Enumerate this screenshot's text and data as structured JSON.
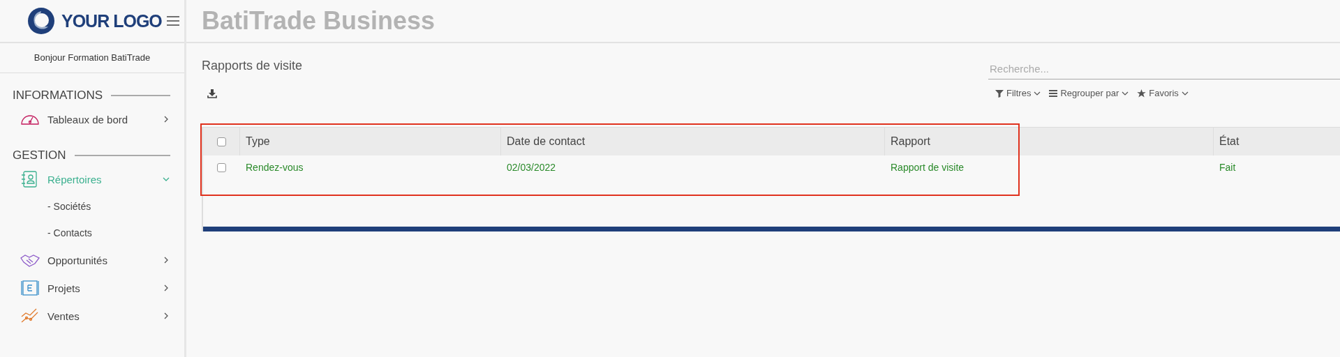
{
  "logo": {
    "text": "YOUR LOGO"
  },
  "app_title": "BatiTrade Business",
  "greeting": "Bonjour Formation BatiTrade",
  "sidebar": {
    "sections": [
      {
        "title": "INFORMATIONS",
        "items": [
          {
            "label": "Tableaux de bord",
            "expanded": false
          }
        ]
      },
      {
        "title": "GESTION",
        "items": [
          {
            "label": "Répertoires",
            "expanded": true,
            "children": [
              {
                "label": "- Sociétés"
              },
              {
                "label": "- Contacts"
              }
            ]
          },
          {
            "label": "Opportunités",
            "expanded": false
          },
          {
            "label": "Projets",
            "expanded": false
          },
          {
            "label": "Ventes",
            "expanded": false
          }
        ]
      }
    ]
  },
  "page_title": "Rapports de visite",
  "search": {
    "placeholder": "Recherche..."
  },
  "filters": [
    "Filtres",
    "Regrouper par",
    "Favoris"
  ],
  "table": {
    "columns": [
      "Type",
      "Date de contact",
      "Rapport",
      "État"
    ],
    "header_checked": false,
    "rows": [
      {
        "checked": false,
        "cells": [
          "Rendez-vous",
          "02/03/2022",
          "Rapport de visite",
          "Fait"
        ]
      }
    ]
  }
}
